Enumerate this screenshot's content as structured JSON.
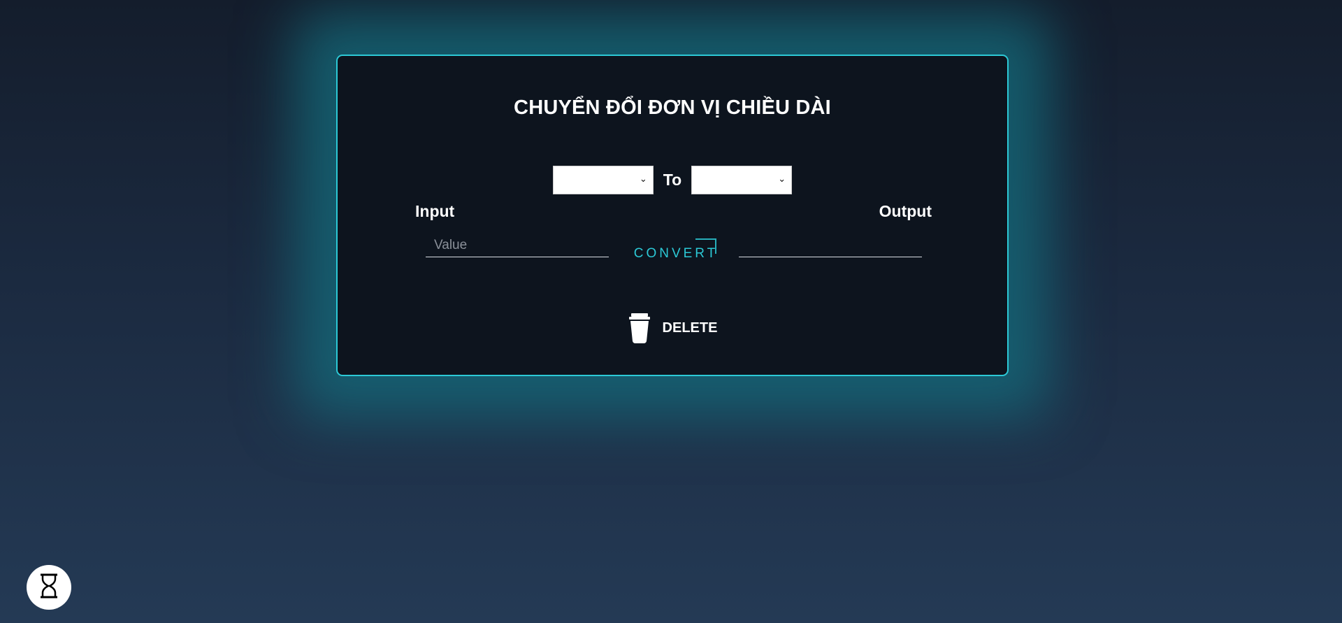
{
  "card": {
    "title": "CHUYỂN ĐỔI ĐƠN VỊ CHIỀU DÀI"
  },
  "units": {
    "from_value": "",
    "to_label": "To",
    "to_value": ""
  },
  "labels": {
    "input": "Input",
    "output": "Output"
  },
  "input_field": {
    "placeholder": "Value"
  },
  "convert_button": {
    "label": "CONVERT"
  },
  "delete_button": {
    "label": "DELETE",
    "icon": "trash-icon"
  },
  "floating_button": {
    "icon": "hourglass-icon"
  },
  "colors": {
    "accent": "#2cc9d6",
    "card_background": "#0d141e",
    "page_background": "#1b2a40"
  }
}
